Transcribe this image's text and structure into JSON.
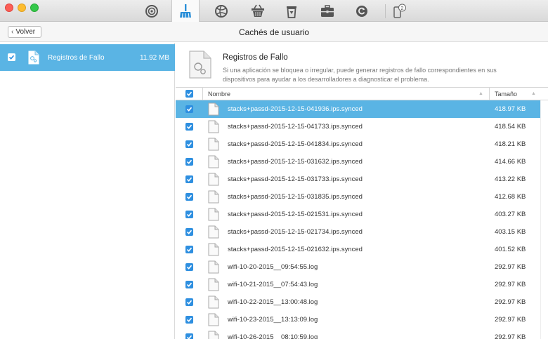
{
  "window": {
    "title": "Cachés de usuario"
  },
  "toolbar": {
    "tools": [
      {
        "icon": "airdrop-icon",
        "active": false
      },
      {
        "icon": "broom-clean-icon",
        "active": true
      },
      {
        "icon": "globe-icon",
        "active": false
      },
      {
        "icon": "basket-icon",
        "active": false
      },
      {
        "icon": "trash-icon",
        "active": false
      },
      {
        "icon": "toolbox-icon",
        "active": false
      },
      {
        "icon": "restore-icon",
        "active": false
      },
      {
        "icon": "device-icon",
        "active": false
      }
    ],
    "device_badge": "2"
  },
  "header": {
    "back_label": "Volver",
    "title": "Cachés de usuario"
  },
  "sidebar": {
    "items": [
      {
        "label": "Registros de Fallo",
        "size": "11.92 MB",
        "checked": true,
        "selected": true
      }
    ]
  },
  "info": {
    "title": "Registros de Fallo",
    "description": "Si una aplicación se bloquea o irregular, puede generar registros de fallo correspondientes en sus dispositivos para ayudar a los desarrolladores a diagnosticar el problema."
  },
  "table": {
    "columns": {
      "name": "Nombre",
      "size": "Tamaño"
    },
    "rows": [
      {
        "name": "stacks+passd-2015-12-15-041936.ips.synced",
        "size": "418.97 KB",
        "selected": true
      },
      {
        "name": "stacks+passd-2015-12-15-041733.ips.synced",
        "size": "418.54 KB"
      },
      {
        "name": "stacks+passd-2015-12-15-041834.ips.synced",
        "size": "418.21 KB"
      },
      {
        "name": "stacks+passd-2015-12-15-031632.ips.synced",
        "size": "414.66 KB"
      },
      {
        "name": "stacks+passd-2015-12-15-031733.ips.synced",
        "size": "413.22 KB"
      },
      {
        "name": "stacks+passd-2015-12-15-031835.ips.synced",
        "size": "412.68 KB"
      },
      {
        "name": "stacks+passd-2015-12-15-021531.ips.synced",
        "size": "403.27 KB"
      },
      {
        "name": "stacks+passd-2015-12-15-021734.ips.synced",
        "size": "403.15 KB"
      },
      {
        "name": "stacks+passd-2015-12-15-021632.ips.synced",
        "size": "401.52 KB"
      },
      {
        "name": "wifi-10-20-2015__09:54:55.log",
        "size": "292.97 KB"
      },
      {
        "name": "wifi-10-21-2015__07:54:43.log",
        "size": "292.97 KB"
      },
      {
        "name": "wifi-10-22-2015__13:00:48.log",
        "size": "292.97 KB"
      },
      {
        "name": "wifi-10-23-2015__13:13:09.log",
        "size": "292.97 KB"
      },
      {
        "name": "wifi-10-26-2015__08:10:59.log",
        "size": "292.97 KB"
      }
    ]
  },
  "colors": {
    "accent": "#5ab4e4",
    "checkbox": "#2e8fe0"
  }
}
